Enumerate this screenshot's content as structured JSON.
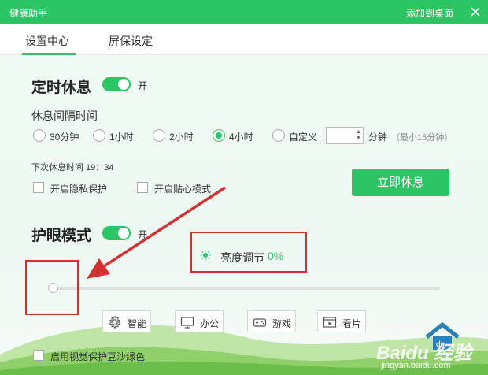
{
  "window": {
    "title": "健康助手",
    "add_to_desktop": "添加到桌面",
    "close_icon": "close-icon"
  },
  "tabs": [
    {
      "label": "设置中心",
      "active": true
    },
    {
      "label": "屏保设定",
      "active": false
    }
  ],
  "scheduled_break": {
    "title": "定时休息",
    "toggle_on": true,
    "toggle_label": "开",
    "interval_label": "休息间隔时间",
    "options": [
      {
        "label": "30分钟",
        "selected": false
      },
      {
        "label": "1小时",
        "selected": false
      },
      {
        "label": "2小时",
        "selected": false
      },
      {
        "label": "4小时",
        "selected": true
      },
      {
        "label": "自定义",
        "selected": false
      }
    ],
    "custom_value": "",
    "custom_unit": "分钟",
    "custom_note": "（最小15分钟）",
    "next_break": "下次休息时间 19：34",
    "privacy_checkbox": "开启隐私保护",
    "caring_checkbox": "开启贴心模式",
    "rest_now_button": "立即休息"
  },
  "eye_care": {
    "title": "护眼模式",
    "toggle_on": true,
    "toggle_label": "开",
    "brightness_label": "亮度调节",
    "brightness_value": "0%",
    "brightness_level": 0,
    "modes": [
      {
        "label": "智能",
        "icon": "smart-mode-icon"
      },
      {
        "label": "办公",
        "icon": "monitor-icon"
      },
      {
        "label": "游戏",
        "icon": "gamepad-icon"
      },
      {
        "label": "看片",
        "icon": "film-icon"
      }
    ],
    "bean_green_checkbox": "启用视觉保护豆沙绿色"
  },
  "watermark": {
    "text": "Baidu 经验",
    "url": "jingyan.baidu.com"
  },
  "colors": {
    "accent": "#2bc564",
    "annotation": "#d43030"
  }
}
